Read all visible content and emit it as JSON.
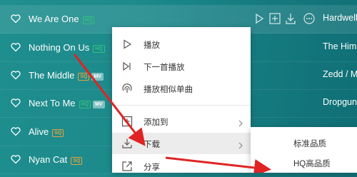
{
  "songs": [
    {
      "title": "We Are One",
      "badges": [
        "HQ"
      ],
      "artist": "Hardwell"
    },
    {
      "title": "Nothing On Us",
      "badges": [
        "HQ"
      ],
      "artist": "The Him"
    },
    {
      "title": "The Middle",
      "badges": [
        "SQ",
        "MV"
      ],
      "artist": "Zedd / M"
    },
    {
      "title": "Next To Me",
      "badges": [
        "HQ",
        "MV"
      ],
      "artist": "Dropgun"
    },
    {
      "title": "Alive",
      "badges": [
        "SQ"
      ],
      "artist": ""
    },
    {
      "title": "Nyan Cat",
      "badges": [
        "SQ"
      ],
      "artist": ""
    }
  ],
  "context_menu": {
    "items": [
      {
        "label": "播放",
        "icon": "play-icon"
      },
      {
        "label": "下一首播放",
        "icon": "play-next-icon"
      },
      {
        "label": "播放相似单曲",
        "icon": "radar-icon"
      },
      {
        "label": "添加到",
        "icon": "add-icon"
      },
      {
        "label": "下载",
        "icon": "download-icon"
      },
      {
        "label": "分享",
        "icon": "share-icon"
      }
    ]
  },
  "download_submenu": {
    "items": [
      {
        "label": "标准品质"
      },
      {
        "label": "HQ高品质"
      }
    ]
  },
  "colors": {
    "accent_green": "#31c27c",
    "sq_gold": "#e6a23c",
    "annotation_red": "#e02424"
  }
}
